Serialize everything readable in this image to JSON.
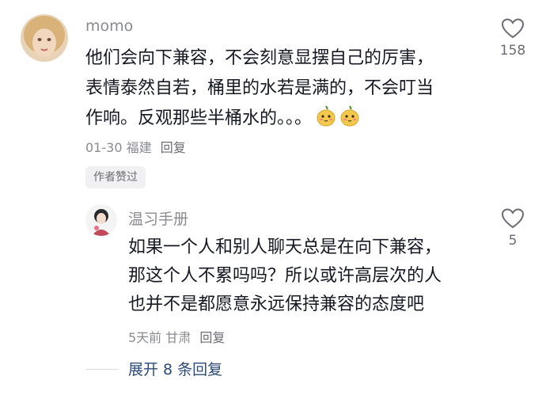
{
  "comment": {
    "username": "momo",
    "lines": [
      "他们会向下兼容，不会刻意显摆自己的厉害，",
      "表情泰然自若，桶里的水若是满的，不会叮当",
      "作响。反观那些半桶水的。。。"
    ],
    "emoji": "pear-face-emoji",
    "meta_date": "01-30",
    "meta_location": "福建",
    "reply_label": "回复",
    "badge": "作者赞过",
    "like_count": "158"
  },
  "reply": {
    "username": "温习手册",
    "lines": [
      "如果一个人和别人聊天总是在向下兼容，",
      "那这个人不累吗吗？所以或许高层次的人",
      "也并不是都愿意永远保持兼容的态度吧"
    ],
    "meta_date": "5天前",
    "meta_location": "甘肃",
    "reply_label": "回复",
    "like_count": "5"
  },
  "expand_label": "展开 8 条回复",
  "colors": {
    "text": "#161823",
    "secondary": "#8a8b91",
    "link": "#2b4a7a",
    "badge_bg": "#f1f1f3"
  },
  "icons": [
    "heart-outline-icon",
    "pear-face-emoji"
  ]
}
